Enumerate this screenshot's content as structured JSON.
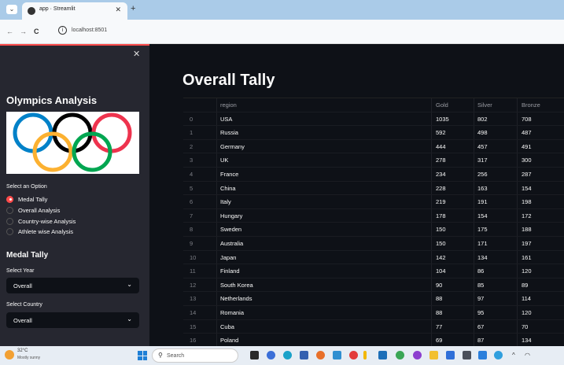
{
  "browser": {
    "tab_title": "app · Streamlit",
    "url": "localhost:8501"
  },
  "sidebar": {
    "title": "Olympics Analysis",
    "select_option_label": "Select an Option",
    "options": [
      {
        "label": "Medal Tally",
        "selected": true
      },
      {
        "label": "Overall Analysis",
        "selected": false
      },
      {
        "label": "Country-wise Analysis",
        "selected": false
      },
      {
        "label": "Athlete wise Analysis",
        "selected": false
      }
    ],
    "section_title": "Medal Tally",
    "select_year_label": "Select Year",
    "select_year_value": "Overall",
    "select_country_label": "Select Country",
    "select_country_value": "Overall"
  },
  "main": {
    "title": "Overall Tally",
    "table": {
      "columns": [
        "region",
        "Gold",
        "Silver",
        "Bronze"
      ],
      "rows": [
        {
          "idx": "0",
          "region": "USA",
          "gold": "1035",
          "silver": "802",
          "bronze": "708"
        },
        {
          "idx": "1",
          "region": "Russia",
          "gold": "592",
          "silver": "498",
          "bronze": "487"
        },
        {
          "idx": "2",
          "region": "Germany",
          "gold": "444",
          "silver": "457",
          "bronze": "491"
        },
        {
          "idx": "3",
          "region": "UK",
          "gold": "278",
          "silver": "317",
          "bronze": "300"
        },
        {
          "idx": "4",
          "region": "France",
          "gold": "234",
          "silver": "256",
          "bronze": "287"
        },
        {
          "idx": "5",
          "region": "China",
          "gold": "228",
          "silver": "163",
          "bronze": "154"
        },
        {
          "idx": "6",
          "region": "Italy",
          "gold": "219",
          "silver": "191",
          "bronze": "198"
        },
        {
          "idx": "7",
          "region": "Hungary",
          "gold": "178",
          "silver": "154",
          "bronze": "172"
        },
        {
          "idx": "8",
          "region": "Sweden",
          "gold": "150",
          "silver": "175",
          "bronze": "188"
        },
        {
          "idx": "9",
          "region": "Australia",
          "gold": "150",
          "silver": "171",
          "bronze": "197"
        },
        {
          "idx": "10",
          "region": "Japan",
          "gold": "142",
          "silver": "134",
          "bronze": "161"
        },
        {
          "idx": "11",
          "region": "Finland",
          "gold": "104",
          "silver": "86",
          "bronze": "120"
        },
        {
          "idx": "12",
          "region": "South Korea",
          "gold": "90",
          "silver": "85",
          "bronze": "89"
        },
        {
          "idx": "13",
          "region": "Netherlands",
          "gold": "88",
          "silver": "97",
          "bronze": "114"
        },
        {
          "idx": "14",
          "region": "Romania",
          "gold": "88",
          "silver": "95",
          "bronze": "120"
        },
        {
          "idx": "15",
          "region": "Cuba",
          "gold": "77",
          "silver": "67",
          "bronze": "70"
        },
        {
          "idx": "16",
          "region": "Poland",
          "gold": "69",
          "silver": "87",
          "bronze": "134"
        }
      ]
    }
  },
  "taskbar": {
    "temperature": "32°C",
    "weather": "Mostly sunny",
    "search_placeholder": "Search"
  },
  "colors": {
    "accent": "#ff4b4b",
    "sidebar_bg": "#262730",
    "main_bg": "#0e1117",
    "ring_blue": "#0081c8",
    "ring_black": "#000000",
    "ring_red": "#ee334e",
    "ring_yellow": "#fcb131",
    "ring_green": "#00a651"
  }
}
